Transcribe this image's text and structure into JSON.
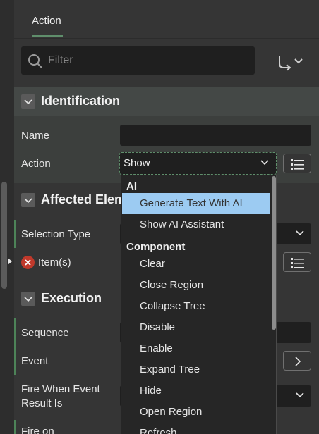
{
  "tabs": [
    {
      "label": "Action"
    }
  ],
  "filter": {
    "placeholder": "Filter",
    "value": ""
  },
  "sections": {
    "identification": {
      "title": "Identification",
      "name_label": "Name",
      "name_value": "",
      "action_label": "Action",
      "action_value": "Show"
    },
    "affected": {
      "title": "Affected Elem",
      "selection_type_label": "Selection Type",
      "items_label": "Item(s)"
    },
    "execution": {
      "title": "Execution",
      "sequence_label": "Sequence",
      "event_label": "Event",
      "fire_when_line1": "Fire When Event",
      "fire_when_line2": "Result Is",
      "fire_on_label": "Fire on"
    }
  },
  "dropdown": {
    "groups": [
      {
        "label": "AI",
        "items": [
          "Generate Text With AI",
          "Show AI Assistant"
        ]
      },
      {
        "label": "Component",
        "items": [
          "Clear",
          "Close Region",
          "Collapse Tree",
          "Disable",
          "Enable",
          "Expand Tree",
          "Hide",
          "Open Region",
          "Refresh"
        ]
      }
    ],
    "highlighted": "Generate Text With AI"
  },
  "colors": {
    "background": "#333333",
    "accent_green": "#5f8e6b",
    "highlight_blue": "#9ccbf2",
    "error_red": "#c0392b"
  },
  "icons": [
    "search-icon",
    "goto-arrow-icon",
    "chevron-down-icon",
    "list-icon",
    "chevron-right-icon",
    "error-x-icon",
    "collapse-icon"
  ]
}
